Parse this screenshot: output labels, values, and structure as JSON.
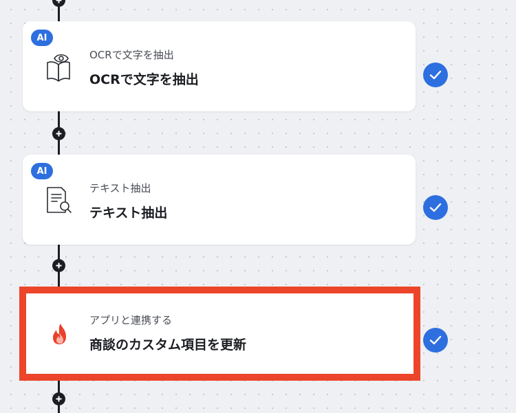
{
  "colors": {
    "accent": "#2e6fe0",
    "highlight_border": "#ec4529",
    "connector": "#1b1d22"
  },
  "flow": {
    "steps": [
      {
        "badge": "AI",
        "icon": "book-eye-icon",
        "subtitle": "OCRで文字を抽出",
        "title": "OCRで文字を抽出",
        "status": "check-icon"
      },
      {
        "badge": "AI",
        "icon": "document-search-icon",
        "subtitle": "テキスト抽出",
        "title": "テキスト抽出",
        "status": "check-icon"
      },
      {
        "icon": "flame-app-icon",
        "subtitle": "アプリと連携する",
        "title": "商談のカスタム項目を更新",
        "status": "check-icon",
        "highlighted": true
      }
    ]
  }
}
